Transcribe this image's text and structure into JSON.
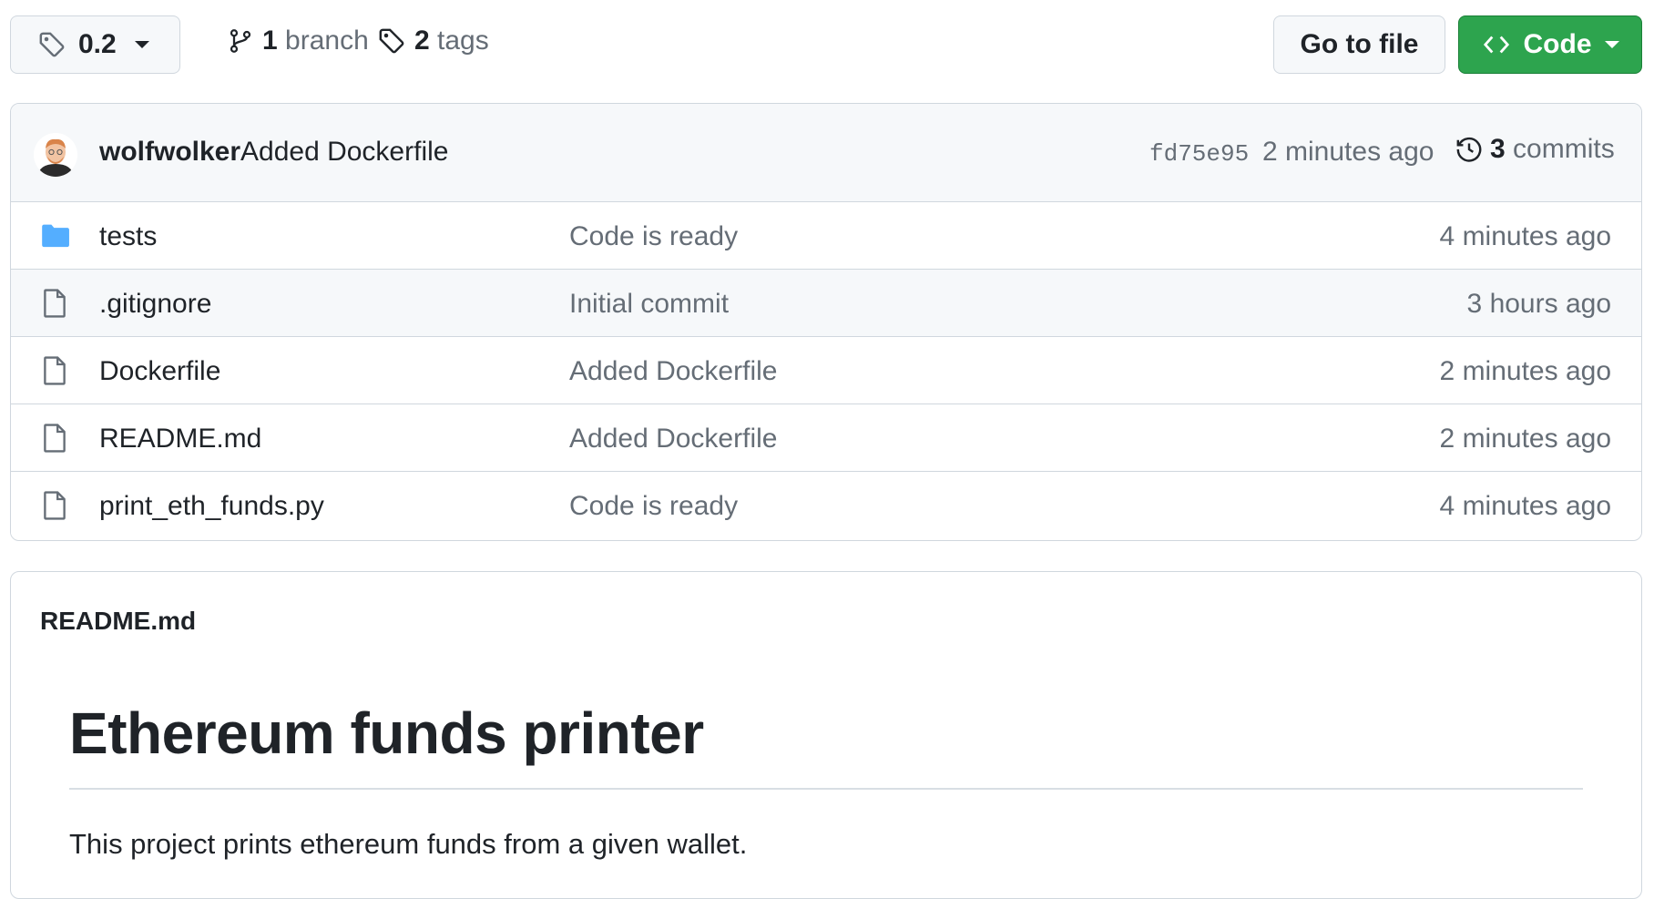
{
  "top_bar": {
    "branch_selector": {
      "value": "0.2",
      "icon": "tag-icon"
    },
    "branches": {
      "count": "1",
      "label": "branch",
      "icon": "git-branch-icon"
    },
    "tags": {
      "count": "2",
      "label": "tags",
      "icon": "tag-icon"
    },
    "goto_file_label": "Go to file",
    "code_button_label": "Code"
  },
  "latest_commit": {
    "author": "wolfwolker",
    "message": "Added Dockerfile",
    "sha": "fd75e95",
    "time": "2 minutes ago",
    "commits_count": "3",
    "commits_label": "commits"
  },
  "files": [
    {
      "name": "tests",
      "type": "folder",
      "commit": "Code is ready",
      "time": "4 minutes ago"
    },
    {
      "name": ".gitignore",
      "type": "file",
      "commit": "Initial commit",
      "time": "3 hours ago"
    },
    {
      "name": "Dockerfile",
      "type": "file",
      "commit": "Added Dockerfile",
      "time": "2 minutes ago"
    },
    {
      "name": "README.md",
      "type": "file",
      "commit": "Added Dockerfile",
      "time": "2 minutes ago"
    },
    {
      "name": "print_eth_funds.py",
      "type": "file",
      "commit": "Code is ready",
      "time": "4 minutes ago"
    }
  ],
  "readme": {
    "filename": "README.md",
    "heading": "Ethereum funds printer",
    "paragraph": "This project prints ethereum funds from a given wallet."
  },
  "colors": {
    "primary_button": "#2da44e",
    "folder_icon": "#54aeff",
    "muted_text": "#656d76"
  }
}
